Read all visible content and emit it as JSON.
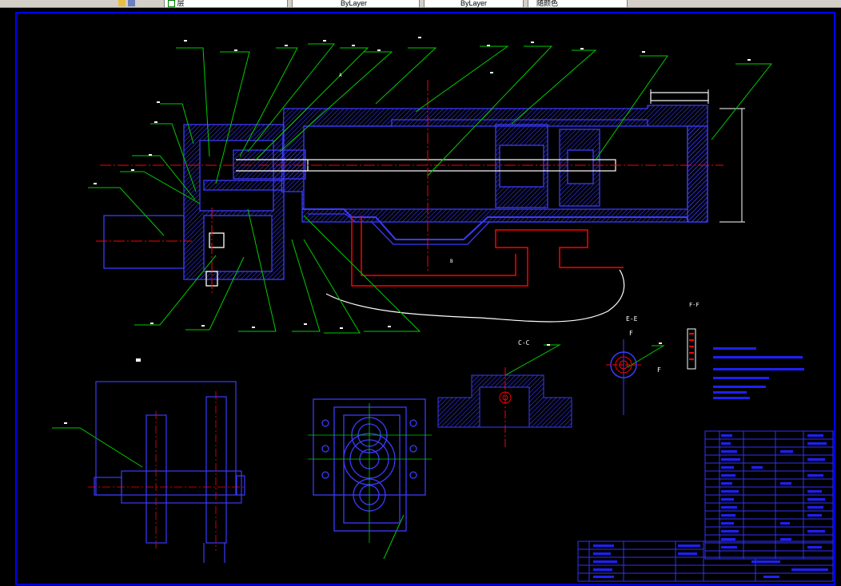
{
  "toolbar": {
    "layer_label": "层",
    "field_a": "ByLayer",
    "field_b": "ByLayer",
    "field_c": "随颜色"
  },
  "colors": {
    "background": "#000000",
    "frame": "#0000ff",
    "leader": "#00cc00",
    "centerline": "#ff0000",
    "outline": "#ffffff",
    "hatch": "#3030ff"
  },
  "drawing": {
    "section_label_ce": "C-C",
    "section_label_ee": "E-E",
    "section_label_ff": "F-F",
    "view_label_f": "F",
    "label_a": "A",
    "label_b": "B"
  }
}
